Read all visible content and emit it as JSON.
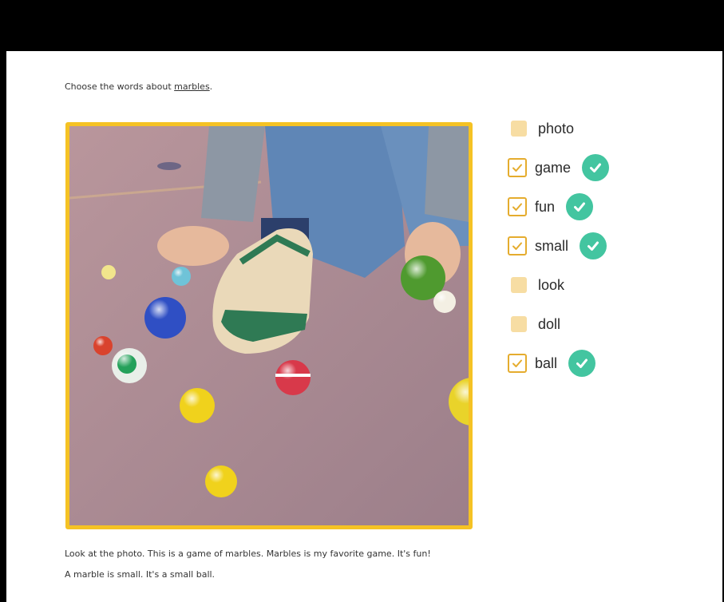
{
  "instruction": {
    "prefix": "Choose the words about ",
    "keyword": "marbles",
    "suffix": "."
  },
  "photo": {
    "alt": ""
  },
  "options": [
    {
      "label": "photo",
      "checked": false,
      "correct": false
    },
    {
      "label": "game",
      "checked": true,
      "correct": true
    },
    {
      "label": "fun",
      "checked": true,
      "correct": true
    },
    {
      "label": "small",
      "checked": true,
      "correct": true
    },
    {
      "label": "look",
      "checked": false,
      "correct": false
    },
    {
      "label": "doll",
      "checked": false,
      "correct": false
    },
    {
      "label": "ball",
      "checked": true,
      "correct": true
    }
  ],
  "caption": {
    "line1": "Look at the photo. This is a game of marbles. Marbles is my favorite game. It's fun!",
    "line2": "A marble is small. It's a small ball."
  },
  "colors": {
    "frame": "#f5c224",
    "checkbox_border": "#e5ac2e",
    "checkbox_empty": "#f7dda3",
    "correct_badge": "#43c5a0"
  }
}
